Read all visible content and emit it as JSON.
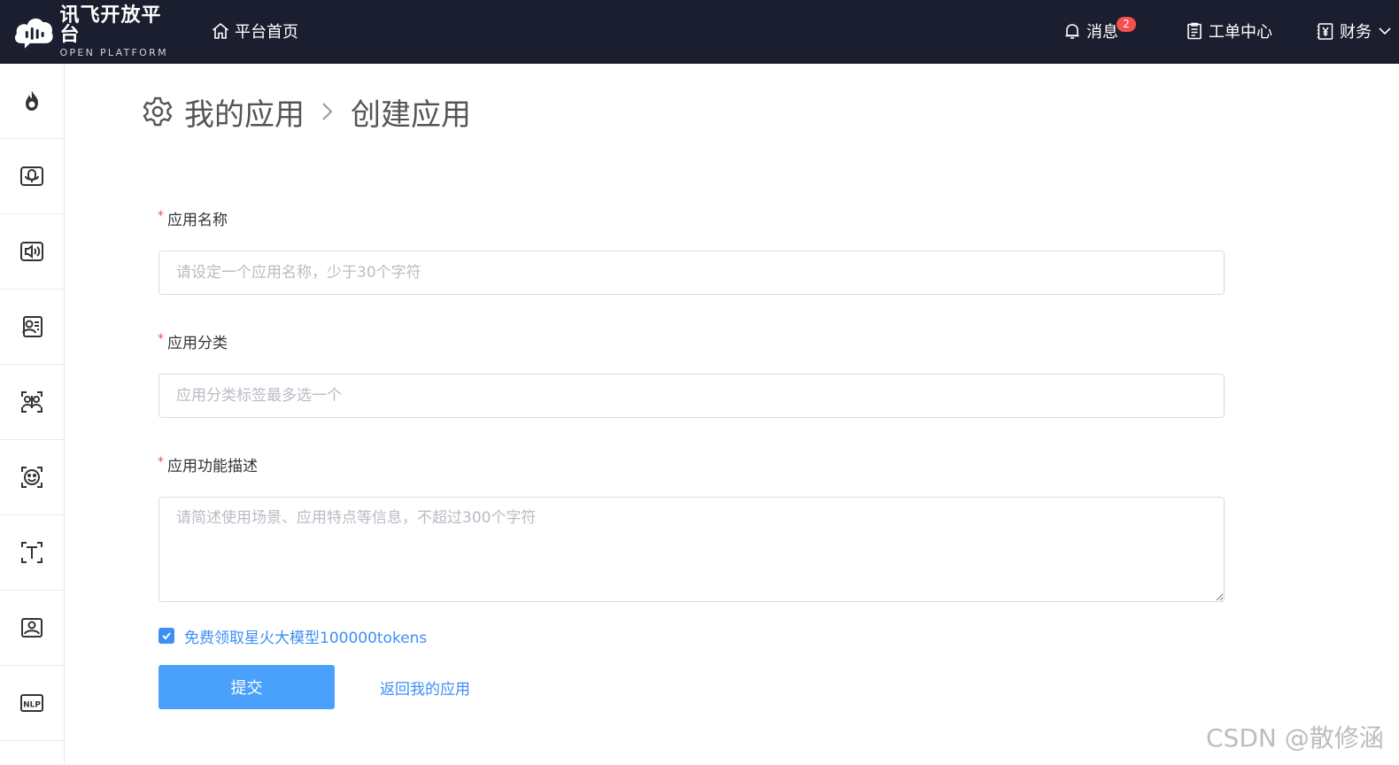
{
  "header": {
    "logo_cn": "讯飞开放平台",
    "logo_en": "OPEN PLATFORM",
    "home_label": "平台首页",
    "messages_label": "消息",
    "messages_badge": "2",
    "tickets_label": "工单中心",
    "finance_label": "财务"
  },
  "sidebar": {
    "items": [
      {
        "icon": "flame-icon"
      },
      {
        "icon": "speech-recognition-icon"
      },
      {
        "icon": "speech-synthesis-icon"
      },
      {
        "icon": "voice-transcript-icon"
      },
      {
        "icon": "face-compare-icon"
      },
      {
        "icon": "face-detection-icon"
      },
      {
        "icon": "text-recognition-icon"
      },
      {
        "icon": "image-recognition-icon"
      },
      {
        "icon": "nlp-icon"
      }
    ]
  },
  "breadcrumb": {
    "parent": "我的应用",
    "current": "创建应用"
  },
  "form": {
    "name_label": "应用名称",
    "name_placeholder": "请设定一个应用名称，少于30个字符",
    "category_label": "应用分类",
    "category_placeholder": "应用分类标签最多选一个",
    "description_label": "应用功能描述",
    "description_placeholder": "请简述使用场景、应用特点等信息，不超过300个字符",
    "required_mark": "*",
    "tokens_checkbox_label": "免费领取星火大模型100000tokens",
    "tokens_checked": true,
    "submit_label": "提交",
    "back_label": "返回我的应用"
  },
  "watermark": "CSDN @散修涵",
  "colors": {
    "topbar_bg": "#1a1e2e",
    "accent": "#3d8ff5",
    "primary_button": "#4aa1fb",
    "required": "#f5504e"
  }
}
